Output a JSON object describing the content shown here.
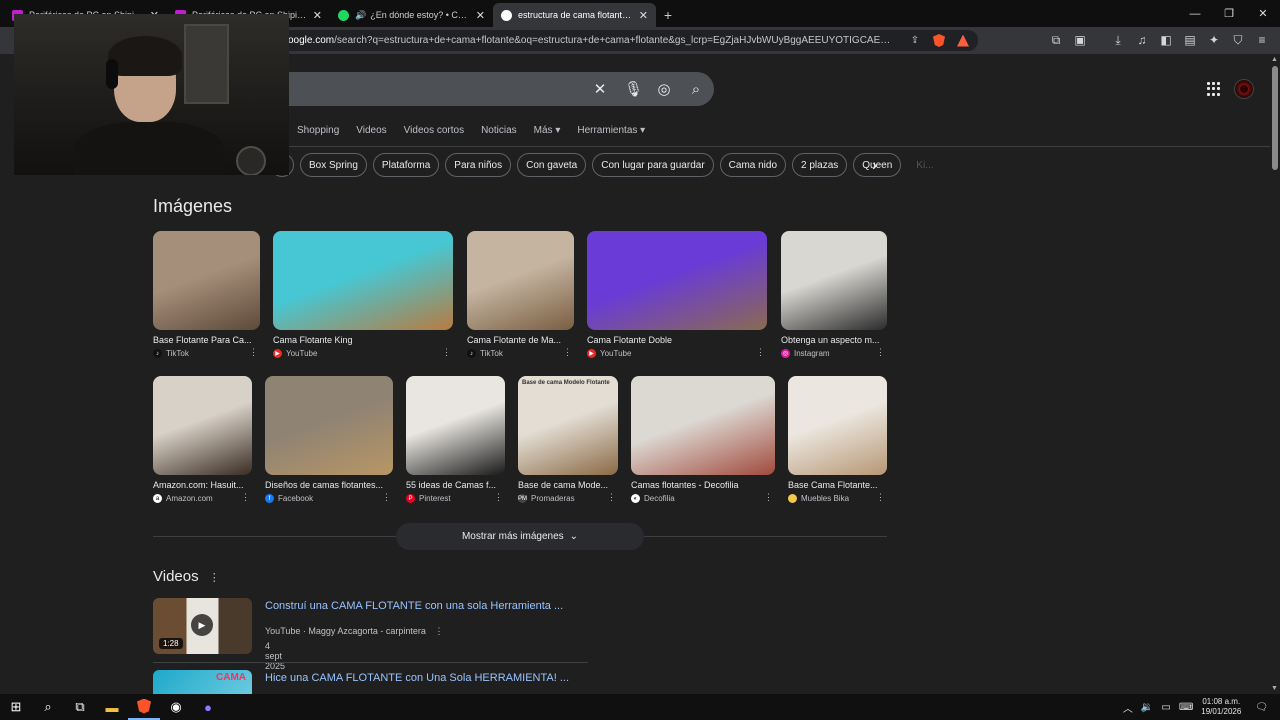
{
  "tabs": [
    {
      "title": "Periféricos de PC en Shipin | Envíos a",
      "favicon_color": "#c21bd1",
      "active": false
    },
    {
      "title": "Periféricos de PC en Shipin | Envíos a",
      "favicon_color": "#c21bd1",
      "active": false
    },
    {
      "title": "¿En dónde estoy? • Cerounno, Vi",
      "favicon_color": "#1ed760",
      "active": false,
      "audio": true
    },
    {
      "title": "estructura de cama flotante - Bu",
      "favicon_color": "#ffffff",
      "active": true
    }
  ],
  "new_tab_label": "+",
  "window_controls": {
    "minimize": "—",
    "restore": "❐",
    "close": "✕"
  },
  "address_bar": {
    "url_prefix": "oogle.com",
    "url_rest": "/search?q=estructura+de+cama+flotante&oq=estructura+de+cama+flotante&gs_lcrp=EgZjaHJvbWUyBggAEEUYOTIGCAEQLhhA0gEIOD...",
    "shields_badge": "1"
  },
  "nav_tabs": [
    "Shopping",
    "Videos",
    "Videos cortos",
    "Noticias",
    "Más ▾",
    "Herramientas ▾"
  ],
  "chips": [
    "Box Spring",
    "Plataforma",
    "Para niños",
    "Con gaveta",
    "Con lugar para guardar",
    "Cama nido",
    "2 plazas",
    "Queen",
    "Ki..."
  ],
  "images_section": {
    "title": "Imágenes",
    "row1": [
      {
        "caption": "Base Flotante Para Ca...",
        "source": "TikTok",
        "source_icon": "tiktok-icon",
        "colors": [
          "#a68f7a",
          "#5e4a3a"
        ]
      },
      {
        "caption": "Cama Flotante King",
        "source": "YouTube",
        "source_icon": "youtube-icon",
        "colors": [
          "#47c7d3",
          "#b77b41"
        ]
      },
      {
        "caption": "Cama Flotante de Ma...",
        "source": "TikTok",
        "source_icon": "tiktok-icon",
        "colors": [
          "#c4b4a0",
          "#7a5e42"
        ]
      },
      {
        "caption": "Cama Flotante Doble",
        "source": "YouTube",
        "source_icon": "youtube-icon",
        "colors": [
          "#6a3bd6",
          "#8a6a52"
        ]
      },
      {
        "caption": "Obtenga un aspecto m...",
        "source": "Instagram",
        "source_icon": "instagram-icon",
        "colors": [
          "#d9d7d2",
          "#2b2b2b"
        ]
      }
    ],
    "row2": [
      {
        "caption": "Amazon.com: Hasuit...",
        "source": "Amazon.com",
        "source_icon": "amazon-icon",
        "colors": [
          "#d8d1c7",
          "#3a2c22"
        ]
      },
      {
        "caption": "Diseños de camas flotantes...",
        "source": "Facebook",
        "source_icon": "facebook-icon",
        "colors": [
          "#8f8374",
          "#b89664"
        ]
      },
      {
        "caption": "55 ideas de Camas f...",
        "source": "Pinterest",
        "source_icon": "pinterest-icon",
        "colors": [
          "#e9e6e1",
          "#1a1a1a"
        ]
      },
      {
        "caption": "Base de cama Mode...",
        "source": "Promaderas",
        "source_icon": "promaderas-icon",
        "colors": [
          "#e3ddd4",
          "#8b6a45"
        ]
      },
      {
        "caption": "Camas flotantes - Decofilia",
        "source": "Decofilia",
        "source_icon": "decofilia-icon",
        "colors": [
          "#dcd8d2",
          "#a14a3d"
        ]
      },
      {
        "caption": "Base Cama Flotante...",
        "source": "Muebles Bika",
        "source_icon": "bika-icon",
        "colors": [
          "#ebe6df",
          "#b79774"
        ]
      }
    ],
    "overlay_texts": {
      "promaderas_image": "Base de cama Modelo Flotante"
    },
    "show_more": "Mostrar más imágenes"
  },
  "videos_section": {
    "title": "Videos",
    "items": [
      {
        "title": "Construí una CAMA FLOTANTE con una sola Herramienta ...",
        "platform": "YouTube",
        "channel": "Maggy Azcagorta - carpintera",
        "date": "4 sept 2025",
        "duration": "1:28"
      },
      {
        "title": "Hice una CAMA FLOTANTE con Una Sola HERRAMIENTA! ...",
        "thumb_text": "CAMA"
      }
    ]
  },
  "taskbar": {
    "time": "01:08 a.m.",
    "date": "19/01/2026"
  },
  "colors": {
    "link": "#99c3ff",
    "background": "#1f1f1f",
    "chip_border": "#5f6368"
  }
}
